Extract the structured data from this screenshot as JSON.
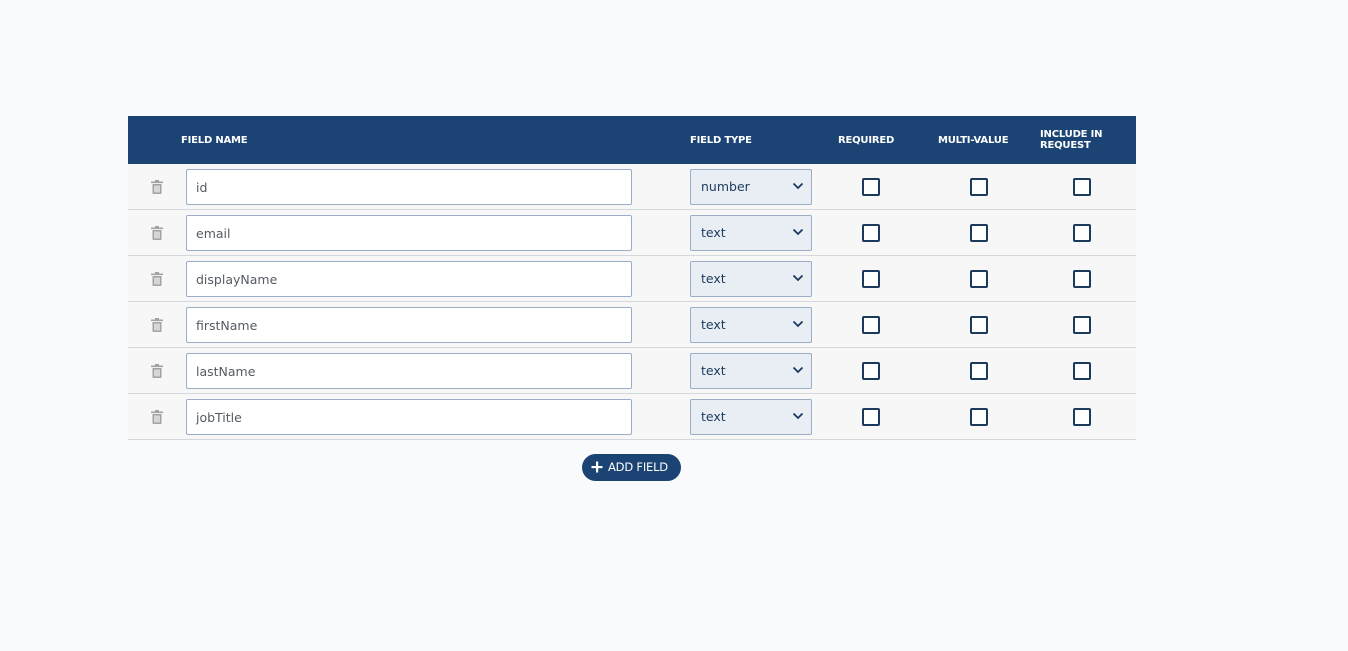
{
  "table": {
    "headers": {
      "field_name": "FIELD NAME",
      "field_type": "FIELD TYPE",
      "required": "REQUIRED",
      "multi_value": "MULTI-VALUE",
      "include_in_request": "INCLUDE IN REQUEST"
    },
    "rows": [
      {
        "name": "id",
        "type": "number",
        "required": false,
        "multi_value": false,
        "include_in_request": false
      },
      {
        "name": "email",
        "type": "text",
        "required": false,
        "multi_value": false,
        "include_in_request": false
      },
      {
        "name": "displayName",
        "type": "text",
        "required": false,
        "multi_value": false,
        "include_in_request": false
      },
      {
        "name": "firstName",
        "type": "text",
        "required": false,
        "multi_value": false,
        "include_in_request": false
      },
      {
        "name": "lastName",
        "type": "text",
        "required": false,
        "multi_value": false,
        "include_in_request": false
      },
      {
        "name": "jobTitle",
        "type": "text",
        "required": false,
        "multi_value": false,
        "include_in_request": false
      }
    ]
  },
  "add_field_button": {
    "label": "ADD FIELD",
    "icon": "plus-icon"
  },
  "icons": {
    "delete": "trash-icon",
    "dropdown": "chevron-down-icon"
  },
  "colors": {
    "header_bg": "#1b4373",
    "accent": "#1b3a5c",
    "row_bg": "#f7f7f7",
    "page_bg": "#f9fafc",
    "trash": "#a3a3a3"
  }
}
